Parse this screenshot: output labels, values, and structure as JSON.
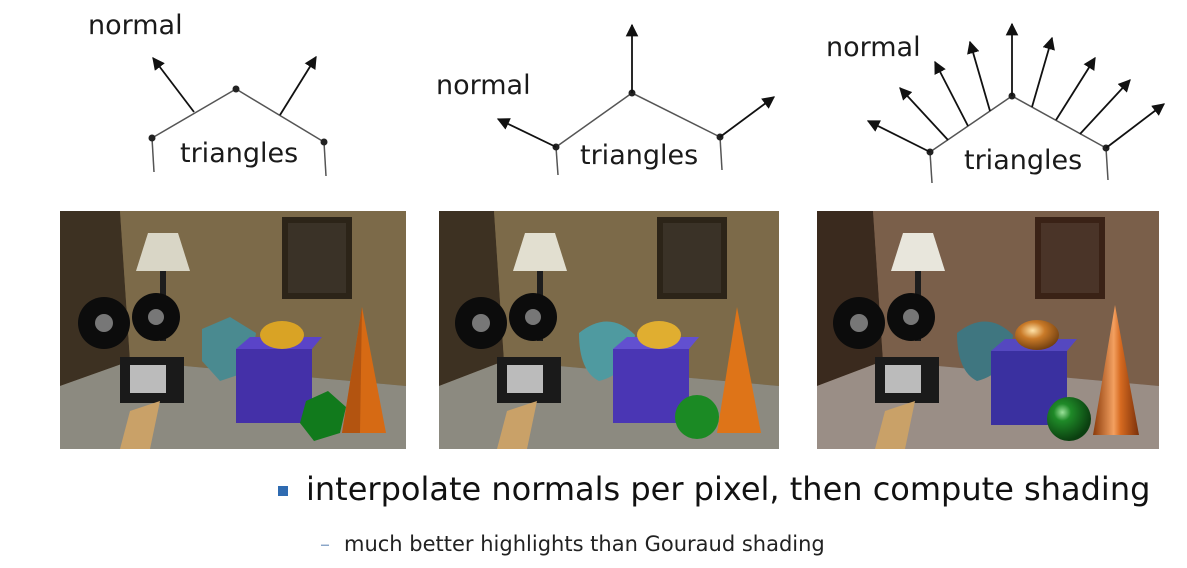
{
  "diagrams": [
    {
      "normal_label": "normal",
      "triangles_label": "triangles"
    },
    {
      "normal_label": "normal",
      "triangles_label": "triangles"
    },
    {
      "normal_label": "normal",
      "triangles_label": "triangles"
    }
  ],
  "bullet": {
    "main": "interpolate normals per pixel, then compute shading",
    "sub": "much better highlights than Gouraud shading"
  },
  "colors": {
    "bullet_accent": "#2f6bb1",
    "sub_dash": "#8aa6c8"
  }
}
